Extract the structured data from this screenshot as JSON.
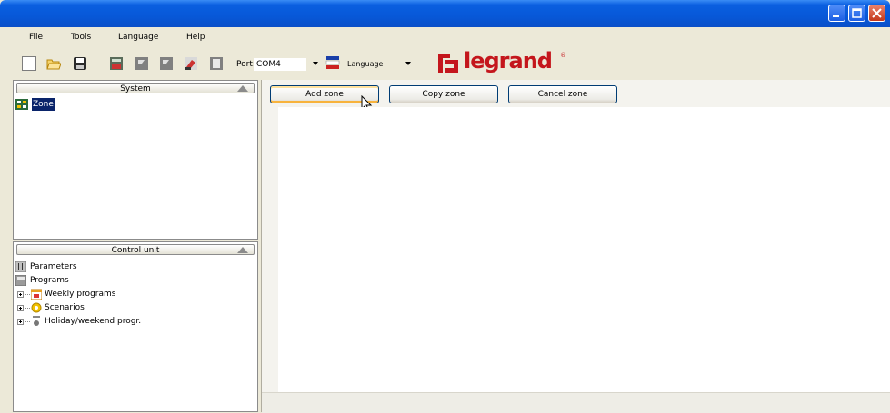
{
  "menu": {
    "items": [
      "File",
      "Tools",
      "Language",
      "Help"
    ]
  },
  "toolbar": {
    "icons": [
      "new-file-icon",
      "open-folder-icon",
      "save-icon",
      "calculator-icon",
      "flag-icon",
      "flag-icon",
      "paint-icon",
      "document-icon"
    ],
    "port_label": "Port:",
    "port_value": "COM4",
    "language_label": "Language",
    "logo_text": "legrand",
    "logo_reg": "®",
    "brand_color": "#c4161c"
  },
  "system_panel": {
    "header": "System",
    "items": [
      {
        "label": "Zone",
        "icon": "zone-icon",
        "selected": true
      }
    ]
  },
  "control_panel": {
    "header": "Control unit",
    "items": [
      {
        "label": "Parameters",
        "icon": "parameters-icon"
      },
      {
        "label": "Programs",
        "icon": "programs-icon"
      },
      {
        "label": "Weekly programs",
        "icon": "calendar-icon"
      },
      {
        "label": "Scenarios",
        "icon": "scenario-icon"
      },
      {
        "label": "Holiday/weekend progr.",
        "icon": "holiday-icon"
      }
    ]
  },
  "main": {
    "buttons": {
      "add": "Add zone",
      "copy": "Copy zone",
      "cancel": "Cancel zone"
    }
  }
}
